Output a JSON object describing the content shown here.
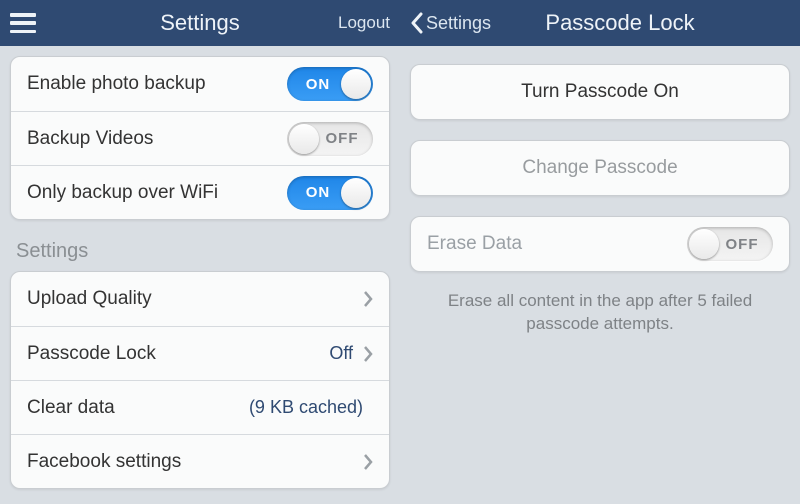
{
  "left": {
    "header": {
      "title": "Settings",
      "logout": "Logout"
    },
    "backup": {
      "enable_photo": {
        "label": "Enable photo backup",
        "on": true
      },
      "backup_videos": {
        "label": "Backup Videos",
        "on": false
      },
      "only_wifi": {
        "label": "Only backup over WiFi",
        "on": true
      }
    },
    "section_title": "Settings",
    "settings": {
      "upload_quality": {
        "label": "Upload Quality"
      },
      "passcode_lock": {
        "label": "Passcode Lock",
        "value": "Off"
      },
      "clear_data": {
        "label": "Clear data",
        "value": "(9 KB cached)"
      },
      "facebook": {
        "label": "Facebook settings"
      }
    },
    "toggle_text": {
      "on": "ON",
      "off": "OFF"
    }
  },
  "right": {
    "header": {
      "back": "Settings",
      "title": "Passcode Lock"
    },
    "turn_on": "Turn Passcode On",
    "change": "Change Passcode",
    "erase": {
      "label": "Erase Data",
      "on": false
    },
    "hint": "Erase all content in the app after 5 failed passcode attempts."
  }
}
